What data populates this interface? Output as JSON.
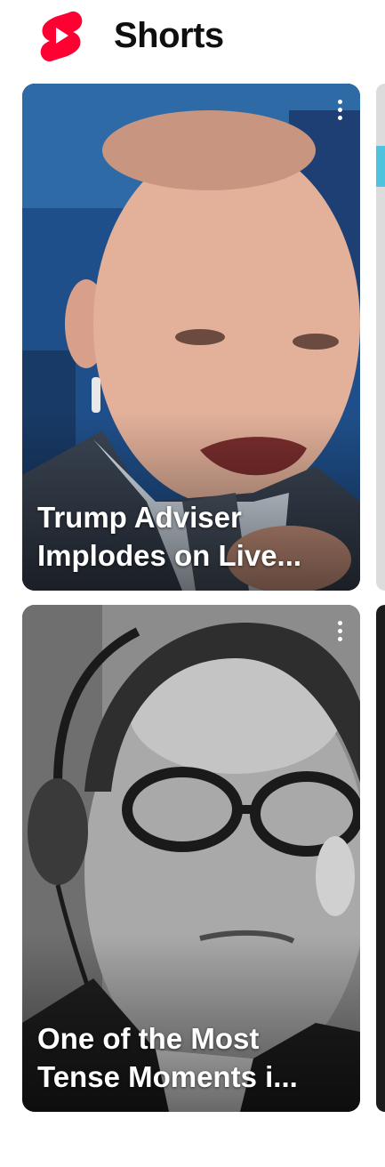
{
  "header": {
    "title": "Shorts",
    "logo_icon": "youtube-shorts-logo-icon",
    "brand_color": "#ff0033"
  },
  "shorts": [
    {
      "title": "Trump Adviser\nImplodes on Live...",
      "menu_icon": "more-vertical-icon"
    },
    {
      "title": "One of the Most\nTense Moments i...",
      "menu_icon": "more-vertical-icon"
    }
  ]
}
